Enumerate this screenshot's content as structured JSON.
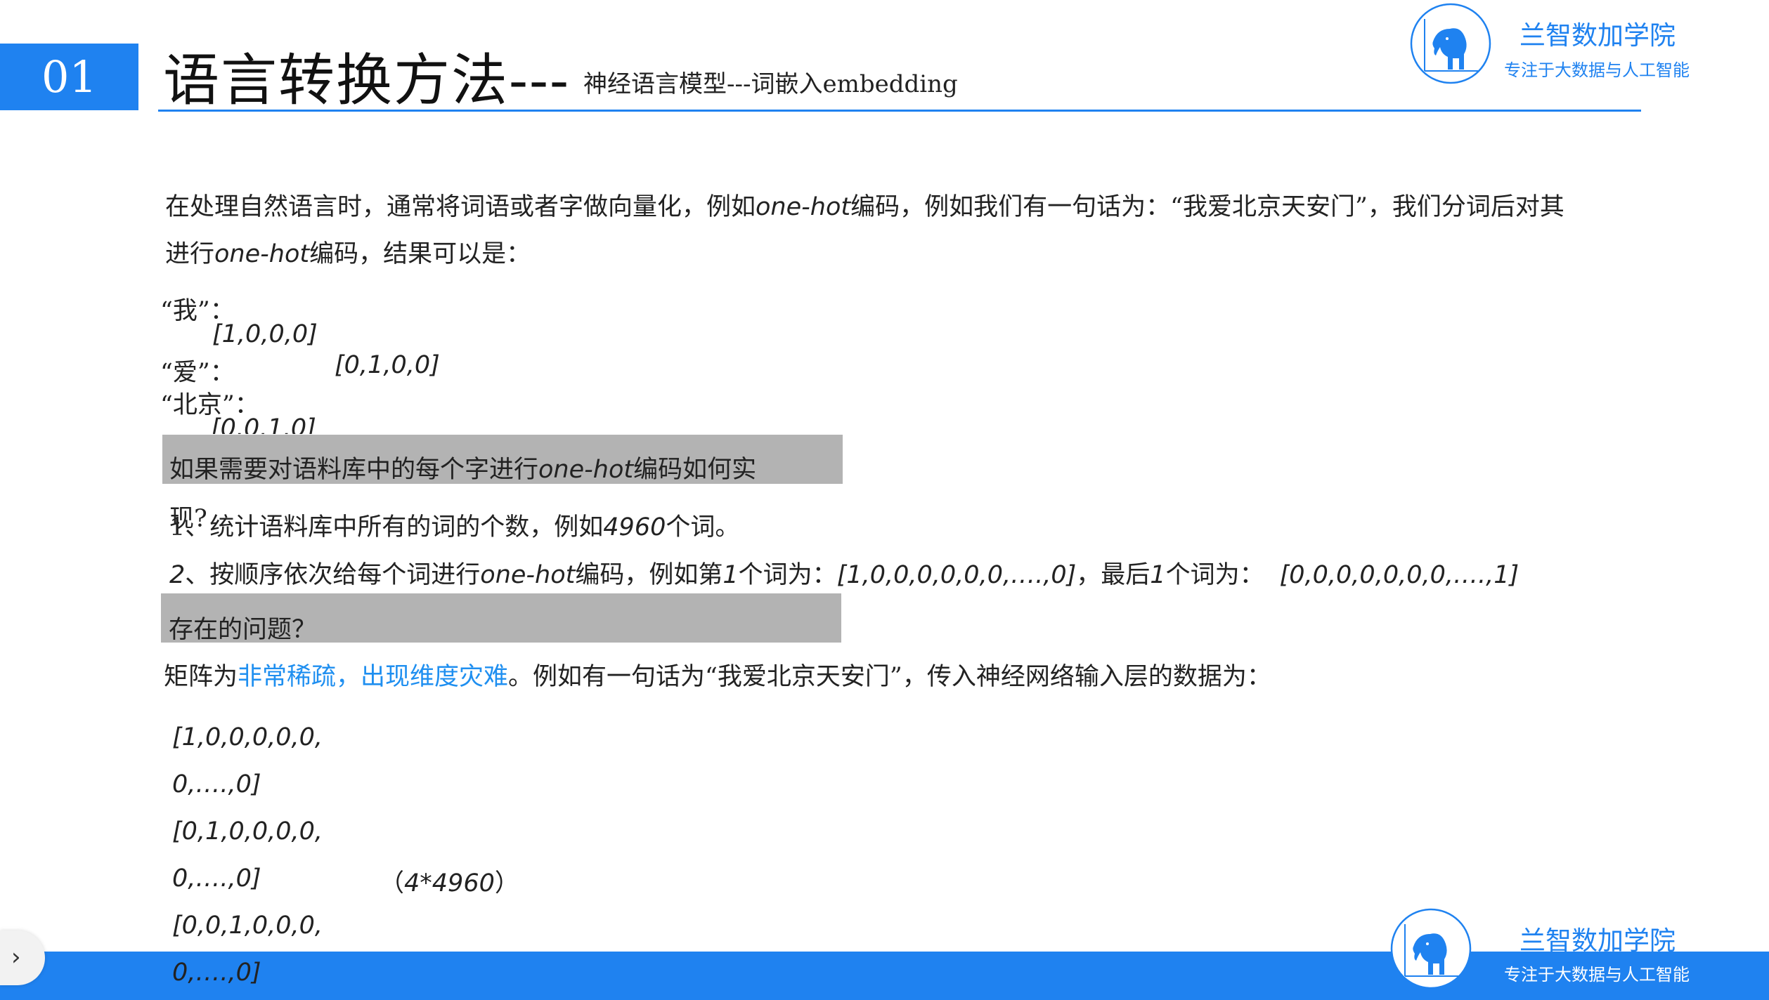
{
  "header": {
    "number": "01",
    "title_main": "语言转换方法---",
    "title_sub": "神经语言模型---词嵌入embedding"
  },
  "brand": {
    "name": "兰智数加学院",
    "tagline": "专注于大数据与人工智能",
    "color": "#1f82f0"
  },
  "intro": {
    "line1_a": "在处理自然语言时，通常将词语或者字做向量化，例如",
    "line1_b": "one-hot",
    "line1_c": "编码，例如我们有一句话为：“我爱北京天安门”，我们分词后对其",
    "line2_a": "进行",
    "line2_b": "one-hot",
    "line2_c": "编码，结果可以是："
  },
  "examples": [
    {
      "word": "“我”：",
      "vector": "[1,0,0,0]"
    },
    {
      "word": "“爱”：",
      "vector": "[0,1,0,0]"
    },
    {
      "word": "“北京”：",
      "vector": "[0,0,1,0]"
    }
  ],
  "question1": {
    "a": "如果需要对语料库中的每个字进行",
    "b": "one-hot",
    "c": "编码如何实",
    "d": "现?"
  },
  "steps": {
    "s1_a": "1、统计语料库中所有的词的个数，例如",
    "s1_b": "4960",
    "s1_c": "个词。",
    "s2_num": "2",
    "s2_a": "、按顺序依次给每个词进行",
    "s2_b": "one-hot",
    "s2_c": "编码，例如第",
    "s2_d": "1",
    "s2_e": "个词为：",
    "s2_f": "[1,0,0,0,0,0,0,….,0]",
    "s2_g": "，最后",
    "s2_h": "1",
    "s2_i": "个词为：",
    "s2_j": "[0,0,0,0,0,0,0,….,1]"
  },
  "question2": "存在的问题？",
  "problem": {
    "a": "矩阵为",
    "b": "非常稀疏，出现维度灾难",
    "c": "。例如有一句话为“我爱北京天安门”，传入神经网络输入层的数据为：",
    "highlight_color": "#1f8ff0"
  },
  "matrix": {
    "rows": [
      {
        "first": "[1,0,0,0,0,0,",
        "second": "0,….,0]"
      },
      {
        "first": "[0,1,0,0,0,0,",
        "second": "0,….,0]"
      },
      {
        "first": "[0,0,1,0,0,0,",
        "second": "0,….,0]"
      }
    ],
    "dims_a": "（",
    "dims_b": "4*4960",
    "dims_c": "）"
  },
  "nav": {
    "chevron_icon": "chevron-right-icon"
  }
}
